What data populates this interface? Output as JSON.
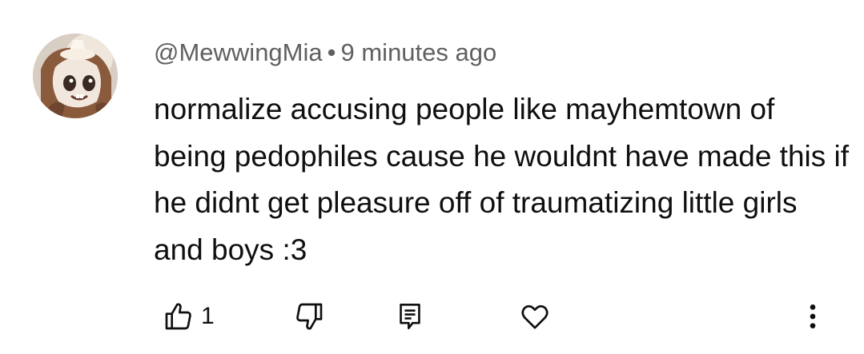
{
  "comment": {
    "author": "@MewwingMia",
    "separator": "•",
    "timestamp": "9 minutes ago",
    "text": "normalize accusing people like mayhemtown of being pedophiles cause he wouldnt have made this if he didnt get pleasure off of traumatizing little girls and boys :3"
  },
  "actions": {
    "like_count": "1",
    "icons": [
      "thumbs-up-icon",
      "thumbs-down-icon",
      "reply-icon",
      "heart-icon",
      "more-vertical-icon"
    ]
  },
  "colors": {
    "text": "#0f0f0f",
    "meta": "#606060",
    "background": "#ffffff"
  }
}
